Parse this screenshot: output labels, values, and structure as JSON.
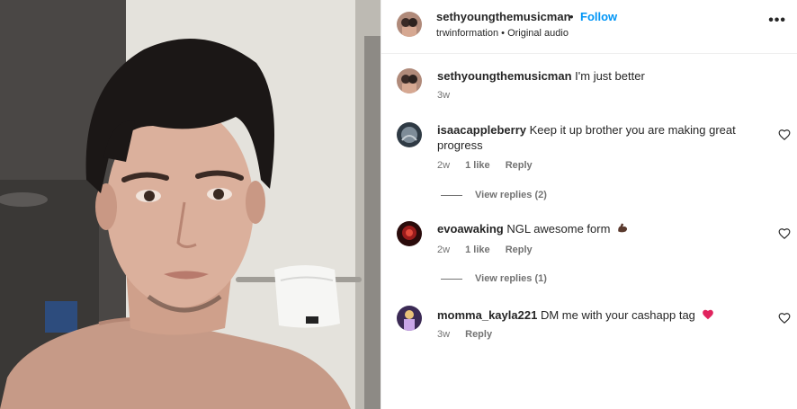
{
  "post": {
    "author": "sethyoungthemusicman",
    "separator": "•",
    "follow_label": "Follow",
    "audio_owner": "trwinformation",
    "audio_separator": "•",
    "audio_label": "Original audio",
    "more_label": "•••"
  },
  "caption": {
    "user": "sethyoungthemusicman",
    "text": "I'm just better",
    "time": "3w"
  },
  "comments": [
    {
      "user": "isaacappleberry",
      "text": "Keep it up brother you are making great progress",
      "time": "2w",
      "likes": "1 like",
      "reply_label": "Reply",
      "view_replies": "View replies (2)"
    },
    {
      "user": "evoawaking",
      "text": "NGL awesome form",
      "emoji": "flexed-biceps",
      "time": "2w",
      "likes": "1 like",
      "reply_label": "Reply",
      "view_replies": "View replies (1)"
    },
    {
      "user": "momma_kayla221",
      "text": "DM me with your cashapp tag",
      "emoji": "red-heart",
      "time": "3w",
      "reply_label": "Reply"
    }
  ],
  "colors": {
    "link_blue": "#0095f6",
    "text_primary": "#262626",
    "text_secondary": "#737373",
    "divider": "#efefef"
  }
}
